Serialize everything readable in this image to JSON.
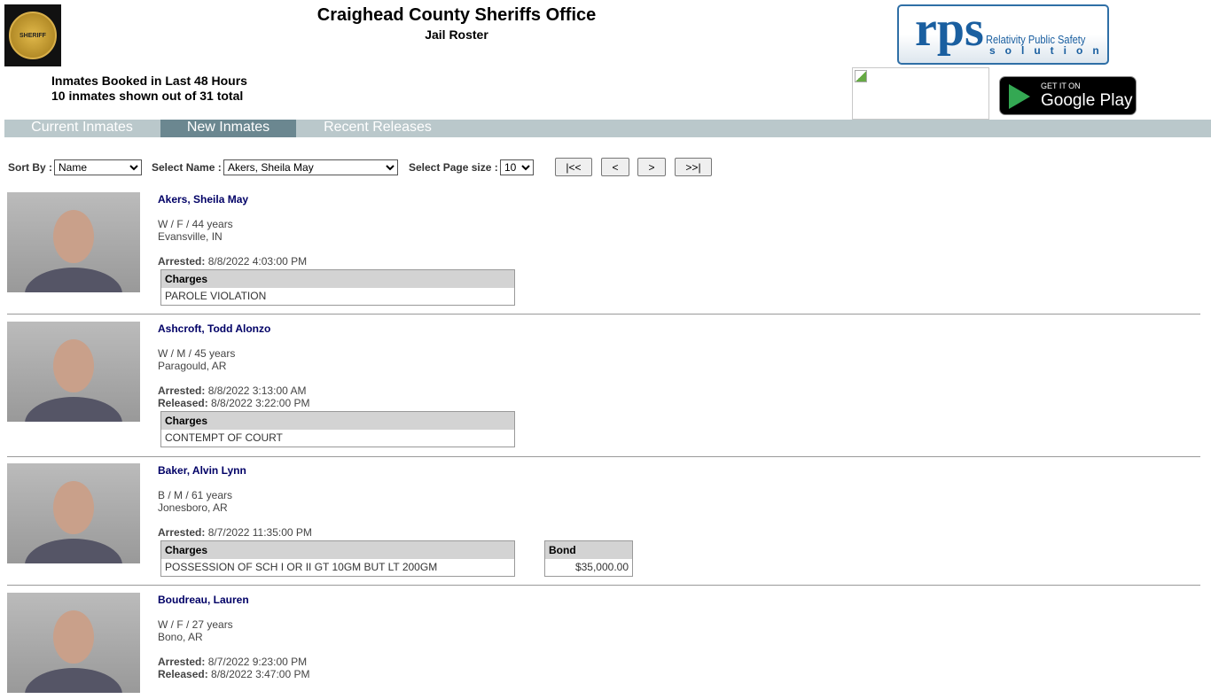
{
  "header": {
    "title": "Craighead County Sheriffs Office",
    "subtitle": "Jail Roster",
    "seal_text": "SHERIFF",
    "booked_title": "Inmates Booked in Last 48 Hours",
    "shown_text": "10 inmates shown out of 31 total"
  },
  "rps_logo": {
    "big": "rps",
    "line1": "Relativity Public Safety",
    "line2": "solutions"
  },
  "google_play": {
    "get": "GET IT ON",
    "store": "Google Play"
  },
  "tabs": [
    {
      "label": "Current Inmates",
      "active": false
    },
    {
      "label": "New Inmates",
      "active": true
    },
    {
      "label": "Recent Releases",
      "active": false
    }
  ],
  "controls": {
    "sort_label": "Sort By :",
    "sort_value": "Name",
    "name_label": "Select Name :",
    "name_value": "Akers, Sheila May",
    "size_label": "Select Page size :",
    "size_value": "10",
    "first": "|<<",
    "prev": "<",
    "next": ">",
    "last": ">>|"
  },
  "labels": {
    "arrested": "Arrested:",
    "released": "Released:",
    "charges": "Charges",
    "bond": "Bond"
  },
  "inmates": [
    {
      "name": "Akers, Sheila May",
      "demo": "W / F / 44 years",
      "city": "Evansville, IN",
      "arrested": "8/8/2022 4:03:00 PM",
      "released": null,
      "charges": [
        "PAROLE VIOLATION"
      ],
      "bond": null
    },
    {
      "name": "Ashcroft, Todd Alonzo",
      "demo": "W / M / 45 years",
      "city": "Paragould, AR",
      "arrested": "8/8/2022 3:13:00 AM",
      "released": "8/8/2022 3:22:00 PM",
      "charges": [
        "CONTEMPT OF COURT"
      ],
      "bond": null
    },
    {
      "name": "Baker, Alvin Lynn",
      "demo": "B / M / 61 years",
      "city": "Jonesboro, AR",
      "arrested": "8/7/2022 11:35:00 PM",
      "released": null,
      "charges": [
        "POSSESSION OF SCH I OR II GT 10GM BUT LT 200GM"
      ],
      "bond": "$35,000.00"
    },
    {
      "name": "Boudreau, Lauren",
      "demo": "W / F / 27 years",
      "city": "Bono, AR",
      "arrested": "8/7/2022 9:23:00 PM",
      "released": "8/8/2022 3:47:00 PM",
      "charges": [],
      "bond": null
    }
  ]
}
